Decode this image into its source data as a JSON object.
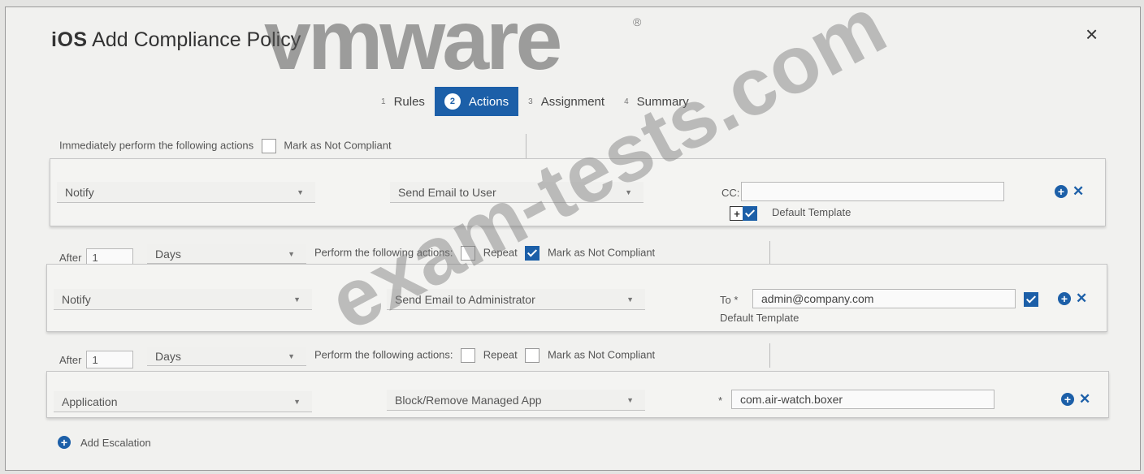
{
  "watermark": {
    "brand": "vmware",
    "reg": "®",
    "site": "exam-tests.com"
  },
  "dialog": {
    "title_prefix": "iOS",
    "title": "Add Compliance Policy",
    "close": "×"
  },
  "steps": [
    {
      "num": "1",
      "label": "Rules",
      "active": false
    },
    {
      "num": "2",
      "label": "Actions",
      "active": true
    },
    {
      "num": "3",
      "label": "Assignment",
      "active": false
    },
    {
      "num": "4",
      "label": "Summary",
      "active": false
    }
  ],
  "immediate": {
    "text": "Immediately perform the following actions",
    "mark_label": "Mark as Not Compliant",
    "mark_checked": false,
    "action": {
      "type": "Notify",
      "detail": "Send Email to User",
      "cc_label": "CC:",
      "cc_value": "",
      "template_label": "Default Template",
      "template_checked": true
    }
  },
  "escalations": [
    {
      "after_label": "After",
      "after_value": "1",
      "unit": "Days",
      "perform_text": "Perform the following actions:",
      "repeat_label": "Repeat",
      "repeat_checked": false,
      "mark_label": "Mark as Not Compliant",
      "mark_checked": true,
      "action": {
        "type": "Notify",
        "detail": "Send Email to Administrator",
        "to_label": "To *",
        "to_value": "admin@company.com",
        "template_label": "Default Template",
        "template_checked": true
      }
    },
    {
      "after_label": "After",
      "after_value": "1",
      "unit": "Days",
      "perform_text": "Perform the following actions:",
      "repeat_label": "Repeat",
      "repeat_checked": false,
      "mark_label": "Mark as Not Compliant",
      "mark_checked": false,
      "action": {
        "type": "Application",
        "detail": "Block/Remove Managed App",
        "app_prefix": "*",
        "app_value": "com.air-watch.boxer"
      }
    }
  ],
  "add_escalation": "Add Escalation",
  "colors": {
    "accent": "#1c5fa8",
    "background": "#f1f1ef"
  }
}
